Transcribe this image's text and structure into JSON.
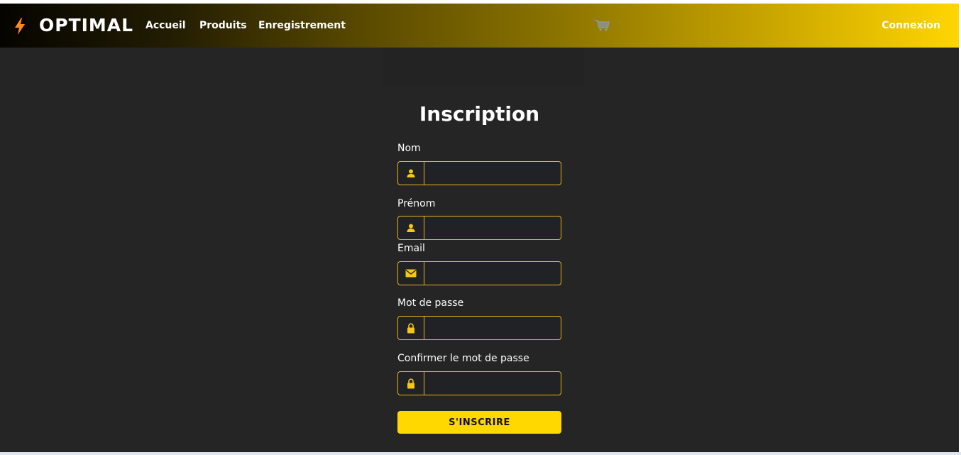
{
  "header": {
    "brand": "OPTIMAL",
    "nav": [
      "Accueil",
      "Produits",
      "Enregistrement"
    ],
    "login": "Connexion",
    "icons": {
      "logo": "lightning-bolt-icon",
      "cart": "shopping-cart-icon"
    }
  },
  "form": {
    "title": "Inscription",
    "fields": [
      {
        "label": "Nom",
        "icon": "user-icon",
        "value": ""
      },
      {
        "label": "Prénom",
        "icon": "user-icon",
        "value": ""
      },
      {
        "label": "Email",
        "icon": "envelope-icon",
        "value": ""
      },
      {
        "label": "Mot de passe",
        "icon": "lock-icon",
        "value": ""
      },
      {
        "label": "Confirmer le mot de passe",
        "icon": "lock-icon",
        "value": ""
      }
    ],
    "submit": "S'INSCRIRE"
  },
  "colors": {
    "background": "#252525",
    "accent": "#ffd800",
    "input_border": "#e6b417",
    "input_bg": "#212226",
    "logo": "#ff8a1c"
  }
}
